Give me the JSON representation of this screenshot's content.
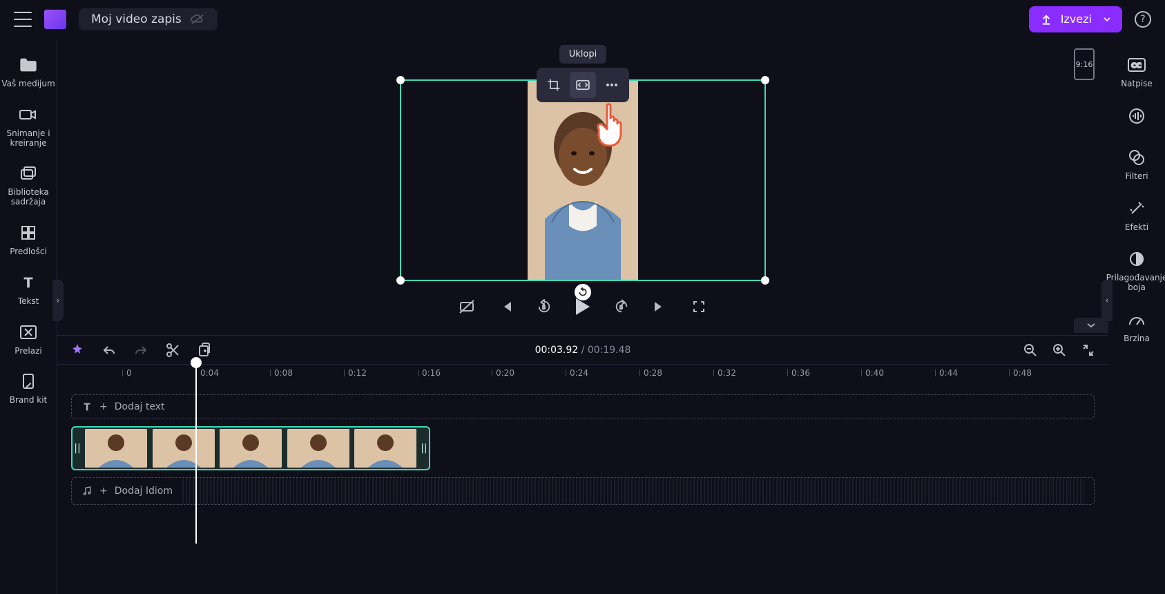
{
  "project_title": "Moj video zapis",
  "tooltip_fit": "Uklopi",
  "export_label": "Izvezi",
  "aspect_label": "9:16",
  "left_sidebar": [
    {
      "label": "Vaš medijum"
    },
    {
      "label": "Snimanje i kreiranje"
    },
    {
      "label": "Biblioteka sadržaja"
    },
    {
      "label": "Predlošci"
    },
    {
      "label": "Tekst"
    },
    {
      "label": "Prelazi"
    },
    {
      "label": "Brand kit"
    }
  ],
  "right_sidebar": [
    {
      "label": "Natpise"
    },
    {
      "label": ""
    },
    {
      "label": "Filteri"
    },
    {
      "label": "Efekti"
    },
    {
      "label": "Prilagođavanje boja"
    },
    {
      "label": "Brzina"
    }
  ],
  "time_current": "00:03.92",
  "time_total": "00:19.48",
  "ruler_ticks": [
    "0",
    "0:04",
    "0:08",
    "0:12",
    "0:16",
    "0:20",
    "0:24",
    "0:28",
    "0:32",
    "0:36",
    "0:40",
    "0:44",
    "0:48"
  ],
  "text_track_placeholder": "Dodaj text",
  "audio_track_placeholder": "Dodaj Idiom",
  "colors": {
    "accent": "#8a2cff",
    "selection": "#3ddbb6"
  }
}
